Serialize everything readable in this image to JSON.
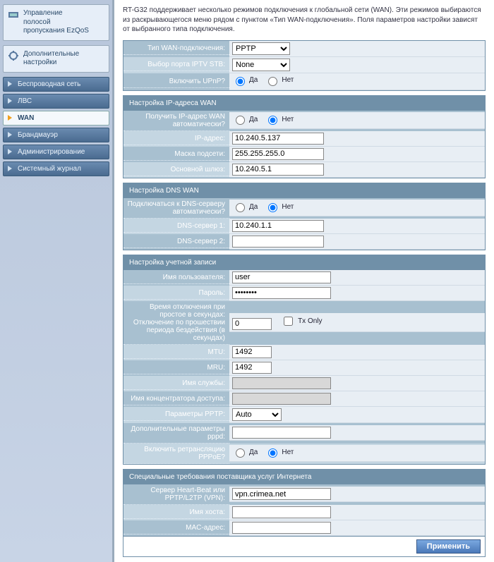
{
  "sidebar": {
    "box1": {
      "l1": "Управление",
      "l2": "полосой",
      "l3": "пропускания EzQoS"
    },
    "box2": {
      "l1": "Дополнительные",
      "l2": "настройки"
    },
    "items": [
      {
        "label": "Беспроводная сеть"
      },
      {
        "label": "ЛВС"
      },
      {
        "label": "WAN"
      },
      {
        "label": "Брандмауэр"
      },
      {
        "label": "Администрирование"
      },
      {
        "label": "Системный журнал"
      }
    ]
  },
  "intro": "RT-G32 поддерживает несколько режимов подключения к глобальной сети (WAN). Эти режимов выбираются из раскрывающегося меню рядом с пунктом «Тип WAN-подключения». Поля параметров настройки зависят от выбранного типа подключения.",
  "panels": {
    "conn": {
      "wan_type_label": "Тип WAN-подключения:",
      "wan_type_value": "PPTP",
      "iptv_label": "Выбор порта IPTV STB:",
      "iptv_value": "None",
      "upnp_label": "Включить UPnP?",
      "yes": "Да",
      "no": "Нет",
      "upnp_selected": "yes"
    },
    "ip": {
      "title": "Настройка IP-адреса WAN",
      "auto_label": "Получить IP-адрес WAN автоматически?",
      "auto_selected": "no",
      "ip_label": "IP-адрес:",
      "ip_value": "10.240.5.137",
      "mask_label": "Маска подсети:",
      "mask_value": "255.255.255.0",
      "gw_label": "Основной шлюз:",
      "gw_value": "10.240.5.1"
    },
    "dns": {
      "title": "Настройка DNS WAN",
      "auto_label": "Подключаться к DNS-серверу автоматически?",
      "auto_selected": "no",
      "dns1_label": "DNS-сервер 1:",
      "dns1_value": "10.240.1.1",
      "dns2_label": "DNS-сервер 2:",
      "dns2_value": ""
    },
    "account": {
      "title": "Настройка учетной записи",
      "user_label": "Имя пользователя:",
      "user_value": "user",
      "pass_label": "Пароль:",
      "pass_value": "••••••••",
      "idle_label": "Время отключения при простое в секундах: Отключение по прошествии периода бездействия (в секундах)",
      "idle_value": "0",
      "txonly_label": "Tx Only",
      "mtu_label": "MTU:",
      "mtu_value": "1492",
      "mru_label": "MRU:",
      "mru_value": "1492",
      "service_label": "Имя службы:",
      "service_value": "",
      "concentrator_label": "Имя концентратора доступа:",
      "concentrator_value": "",
      "pptp_param_label": "Параметры PPTP:",
      "pptp_param_value": "Auto",
      "pppd_extra_label": "Дополнительные параметры pppd:",
      "pppd_extra_value": "",
      "pppoe_relay_label": "Включить ретрансляцию PPPoE?",
      "pppoe_relay_selected": "no"
    },
    "isp": {
      "title": "Специальные требования поставщика услуг Интернета",
      "hb_label": "Сервер Heart-Beat или PPTP/L2TP (VPN):",
      "hb_value": "vpn.crimea.net",
      "host_label": "Имя хоста:",
      "host_value": "",
      "mac_label": "MAC-адрес:",
      "mac_value": ""
    }
  },
  "apply_label": "Применить",
  "radio": {
    "yes": "Да",
    "no": "Нет"
  }
}
